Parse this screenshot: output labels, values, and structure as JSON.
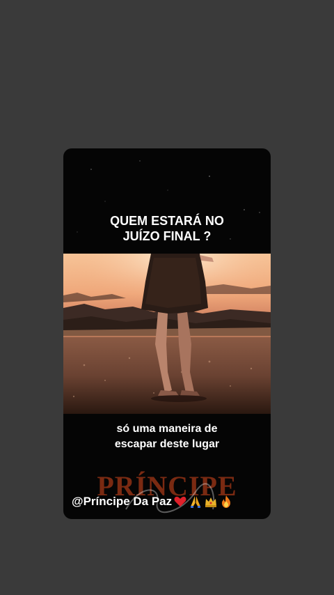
{
  "story": {
    "headline_line1": "QUEM ESTARÁ NO",
    "headline_line2": "JUÍZO FINAL ?",
    "caption_line1": "só uma maneira de",
    "caption_line2": "escapar deste lugar",
    "watermark": "PRÍNCIPE",
    "handle": "@Príncipe Da Paz",
    "emojis": [
      "red-heart-icon",
      "praying-hands-icon",
      "crown-icon",
      "fire-icon"
    ]
  },
  "colors": {
    "background": "#3a3a3a",
    "card": "#050505",
    "watermark": "#7a2a12",
    "heart": "#e0202a",
    "fire": "#f07a18",
    "gold": "#e9b22a"
  }
}
